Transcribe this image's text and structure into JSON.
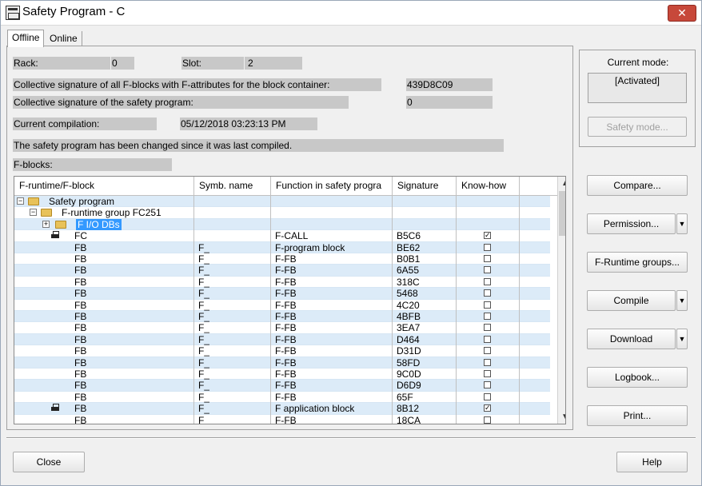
{
  "window": {
    "title": "Safety Program - C",
    "close_glyph": "✕"
  },
  "tabs": [
    {
      "label": "Offline",
      "active": true
    },
    {
      "label": "Online",
      "active": false
    }
  ],
  "info": {
    "rack_label": "Rack:",
    "rack_value": "0",
    "slot_label": "Slot:",
    "slot_value": "2",
    "sig_all_label": "Collective signature of all F-blocks with F-attributes for the block container:",
    "sig_all_value": "439D8C09",
    "sig_prog_label": "Collective signature of the safety program:",
    "sig_prog_value": "0",
    "compilation_label": "Current compilation:",
    "compilation_value": "05/12/2018 03:23:13 PM",
    "changed_message": "The safety program has been changed since it was last compiled.",
    "fblocks_label": "F-blocks:"
  },
  "table": {
    "columns": [
      "F-runtime/F-block",
      "Symb. name",
      "Function in safety progra",
      "Signature",
      "Know-how"
    ],
    "tree": [
      {
        "label": "Safety program",
        "toggle": "−"
      },
      {
        "label": "F-runtime group FC251",
        "toggle": "−"
      },
      {
        "label": "F I/O DBs",
        "toggle": "+"
      }
    ],
    "rows": [
      {
        "block": "FC",
        "symb": "",
        "function": "F-CALL",
        "signature": "B5C6",
        "knowhow": true,
        "icon": true
      },
      {
        "block": "FB",
        "symb": "F_",
        "function": "F-program block",
        "signature": "BE62",
        "knowhow": false,
        "icon": false
      },
      {
        "block": "FB",
        "symb": "F_",
        "function": "F-FB",
        "signature": "B0B1",
        "knowhow": false,
        "icon": false
      },
      {
        "block": "FB",
        "symb": "F_",
        "function": "F-FB",
        "signature": "6A55",
        "knowhow": false,
        "icon": false
      },
      {
        "block": "FB",
        "symb": "F_",
        "function": "F-FB",
        "signature": "318C",
        "knowhow": false,
        "icon": false
      },
      {
        "block": "FB",
        "symb": "F_",
        "function": "F-FB",
        "signature": "5468",
        "knowhow": false,
        "icon": false
      },
      {
        "block": "FB",
        "symb": "F_",
        "function": "F-FB",
        "signature": "4C20",
        "knowhow": false,
        "icon": false
      },
      {
        "block": "FB",
        "symb": "F_",
        "function": "F-FB",
        "signature": "4BFB",
        "knowhow": false,
        "icon": false
      },
      {
        "block": "FB",
        "symb": "F_",
        "function": "F-FB",
        "signature": "3EA7",
        "knowhow": false,
        "icon": false
      },
      {
        "block": "FB",
        "symb": "F_",
        "function": "F-FB",
        "signature": "D464",
        "knowhow": false,
        "icon": false
      },
      {
        "block": "FB",
        "symb": "F_",
        "function": "F-FB",
        "signature": "D31D",
        "knowhow": false,
        "icon": false
      },
      {
        "block": "FB",
        "symb": "F_",
        "function": "F-FB",
        "signature": "58FD",
        "knowhow": false,
        "icon": false
      },
      {
        "block": "FB",
        "symb": "F_",
        "function": "F-FB",
        "signature": "9C0D",
        "knowhow": false,
        "icon": false
      },
      {
        "block": "FB",
        "symb": "F_",
        "function": "F-FB",
        "signature": "D6D9",
        "knowhow": false,
        "icon": false
      },
      {
        "block": "FB",
        "symb": "F_",
        "function": "F-FB",
        "signature": "65F",
        "knowhow": false,
        "icon": false
      },
      {
        "block": "FB",
        "symb": "F_",
        "function": "F application block",
        "signature": "8B12",
        "knowhow": true,
        "icon": true
      },
      {
        "block": "FB",
        "symb": "F_",
        "function": "F-FB",
        "signature": "18CA",
        "knowhow": false,
        "icon": false
      }
    ],
    "check_glyph": "✓",
    "scroll_up_glyph": "▲",
    "scroll_down_glyph": "▼"
  },
  "mode": {
    "label": "Current mode:",
    "value": "[Activated]"
  },
  "buttons": {
    "safety_mode": "Safety mode...",
    "compare": "Compare...",
    "permission": "Permission...",
    "runtime_groups": "F-Runtime groups...",
    "compile": "Compile",
    "download": "Download",
    "logbook": "Logbook...",
    "print": "Print...",
    "close": "Close",
    "help": "Help",
    "dropdown_glyph": "▼"
  }
}
